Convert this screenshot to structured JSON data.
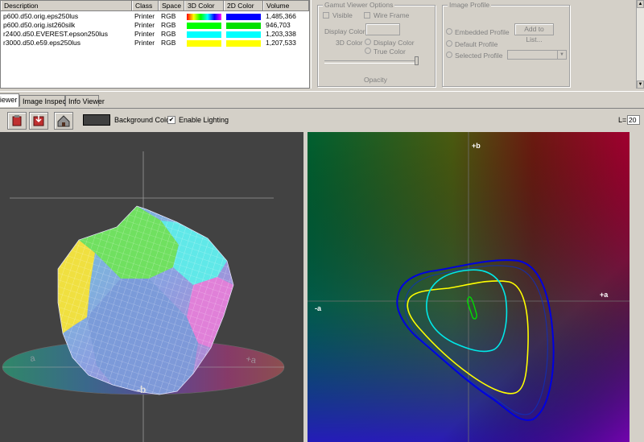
{
  "table": {
    "headers": [
      "Description",
      "Class",
      "Space",
      "3D Color",
      "2D Color",
      "Volume"
    ],
    "rows": [
      {
        "description": "p600.d50.orig.eps250lus",
        "class": "Printer",
        "space": "RGB",
        "color3d": "rainbow",
        "color2d": "#0000ff",
        "volume": "1,485,366"
      },
      {
        "description": "p600.d50.orig.ist260silk",
        "class": "Printer",
        "space": "RGB",
        "color3d": "#00ff00",
        "color2d": "#00e000",
        "volume": "946,703"
      },
      {
        "description": "r2400.d50.EVEREST.epson250lus",
        "class": "Printer",
        "space": "RGB",
        "color3d": "#00ffff",
        "color2d": "#00ffff",
        "volume": "1,203,338"
      },
      {
        "description": "r3000.d50.e59.eps250lus",
        "class": "Printer",
        "space": "RGB",
        "color3d": "#ffff00",
        "color2d": "#ffff00",
        "volume": "1,207,533"
      }
    ]
  },
  "gamut_options": {
    "title": "Gamut Viewer Options",
    "visible_label": "Visible",
    "wire_frame_label": "Wire Frame",
    "display_color_label": "Display Color",
    "color_3d_label": "3D Color",
    "display_color_radio": "Display Color",
    "true_color_radio": "True Color",
    "opacity_label": "Opacity"
  },
  "image_profile": {
    "title": "Image Profile",
    "embedded_label": "Embedded Profile",
    "add_to_list_label": "Add to List...",
    "default_label": "Default Profile",
    "selected_label": "Selected Profile"
  },
  "tabs": [
    {
      "label": "Viewer",
      "active": true
    },
    {
      "label": "Image Inspector",
      "active": false
    },
    {
      "label": "Info Viewer",
      "active": false
    }
  ],
  "toolbar": {
    "background_color_label": "Background Color",
    "background_color": "#404040",
    "enable_lighting_label": "Enable Lighting",
    "enable_lighting_checked": true,
    "l_label": "L=",
    "l_value": "20"
  },
  "viewer3d": {
    "axis_labels": {
      "a_left": "a",
      "a_right": "+a",
      "b_front": "-b"
    }
  },
  "viewer2d": {
    "axis_labels": {
      "plus_b": "+b",
      "plus_a": "+a",
      "minus_a": "-a"
    }
  },
  "colors": {
    "plot_blue": "#0000ff",
    "plot_cyan": "#00e8e8",
    "plot_yellow": "#ffff00",
    "plot_green": "#00dd00",
    "gamut_magenta": "#ff80ff"
  }
}
